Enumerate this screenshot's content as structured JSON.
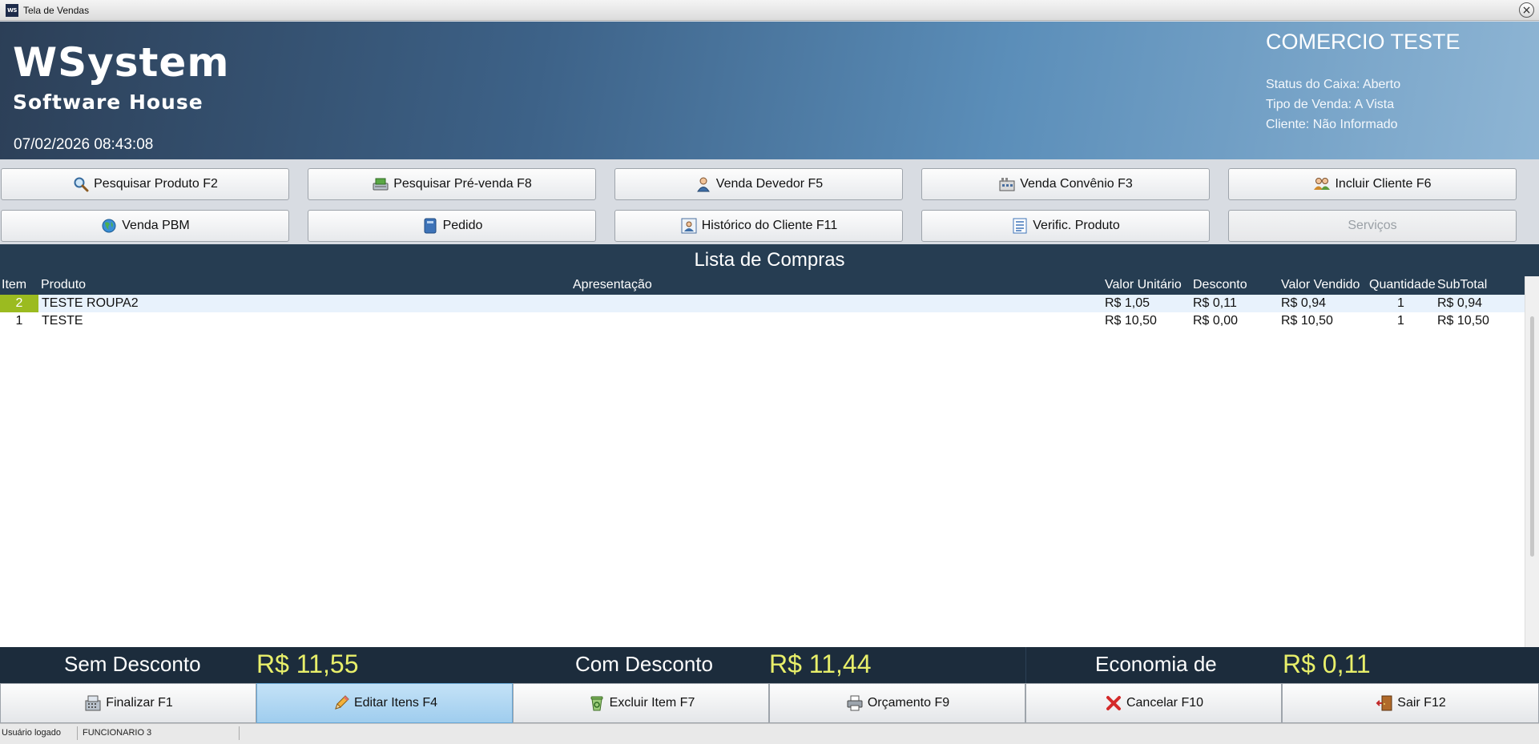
{
  "window": {
    "title": "Tela de Vendas",
    "icon_text": "WS"
  },
  "brand": {
    "name": "WSystem",
    "subtitle": "Software House"
  },
  "datetime": "07/02/2026 08:43:08",
  "store": {
    "company": "COMERCIO TESTE",
    "status_caixa": "Status do Caixa: Aberto",
    "tipo_venda": "Tipo de Venda: A Vista",
    "cliente": "Cliente: Não Informado"
  },
  "toolbar": {
    "row1": [
      {
        "label": "Pesquisar Produto F2",
        "icon": "magnifier-icon"
      },
      {
        "label": "Pesquisar Pré-venda F8",
        "icon": "presale-icon"
      },
      {
        "label": "Venda Devedor F5",
        "icon": "person-icon"
      },
      {
        "label": "Venda Convênio F3",
        "icon": "building-icon"
      },
      {
        "label": "Incluir Cliente F6",
        "icon": "people-icon"
      }
    ],
    "row2": [
      {
        "label": "Venda PBM",
        "icon": "globe-icon"
      },
      {
        "label": "Pedido",
        "icon": "book-icon"
      },
      {
        "label": "Histórico do Cliente F11",
        "icon": "client-history-icon"
      },
      {
        "label": "Verific. Produto",
        "icon": "checklist-icon"
      },
      {
        "label": "Serviços",
        "icon": "",
        "disabled": true
      }
    ]
  },
  "list": {
    "title": "Lista de Compras",
    "columns": {
      "item": "Item",
      "produto": "Produto",
      "apresentacao": "Apresentação",
      "valor_unitario": "Valor Unitário",
      "desconto": "Desconto",
      "valor_vendido": "Valor Vendido",
      "quantidade": "Quantidade",
      "subtotal": "SubTotal"
    },
    "rows": [
      {
        "item": "2",
        "produto": "TESTE ROUPA2",
        "apresentacao": "",
        "valor_unitario": "R$ 1,05",
        "desconto": "R$ 0,11",
        "valor_vendido": "R$ 0,94",
        "quantidade": "1",
        "subtotal": "R$ 0,94",
        "selected": true
      },
      {
        "item": "1",
        "produto": "TESTE",
        "apresentacao": "",
        "valor_unitario": "R$ 10,50",
        "desconto": "R$ 0,00",
        "valor_vendido": "R$ 10,50",
        "quantidade": "1",
        "subtotal": "R$ 10,50",
        "selected": false
      }
    ]
  },
  "totals": {
    "sem_desconto_label": "Sem Desconto",
    "sem_desconto_value": "R$ 11,55",
    "com_desconto_label": "Com Desconto",
    "com_desconto_value": "R$ 11,44",
    "economia_label": "Economia de",
    "economia_value": "R$ 0,11"
  },
  "actions": [
    {
      "label": "Finalizar F1",
      "icon": "register-icon"
    },
    {
      "label": "Editar Itens F4",
      "icon": "pencil-icon",
      "active": true
    },
    {
      "label": "Excluir Item F7",
      "icon": "recycle-bin-icon"
    },
    {
      "label": "Orçamento F9",
      "icon": "printer-icon"
    },
    {
      "label": "Cancelar F10",
      "icon": "red-x-icon"
    },
    {
      "label": "Sair F12",
      "icon": "exit-door-icon"
    }
  ],
  "status": {
    "label": "Usuário logado",
    "user": "FUNCIONARIO 3"
  },
  "colors": {
    "banner_dark": "#2c3f57",
    "banner_light": "#8eb5d4",
    "list_header": "#263d52",
    "total_value": "#e8ef6a",
    "selected_item": "#9bbb20",
    "active_button": "#a8d4f2"
  }
}
